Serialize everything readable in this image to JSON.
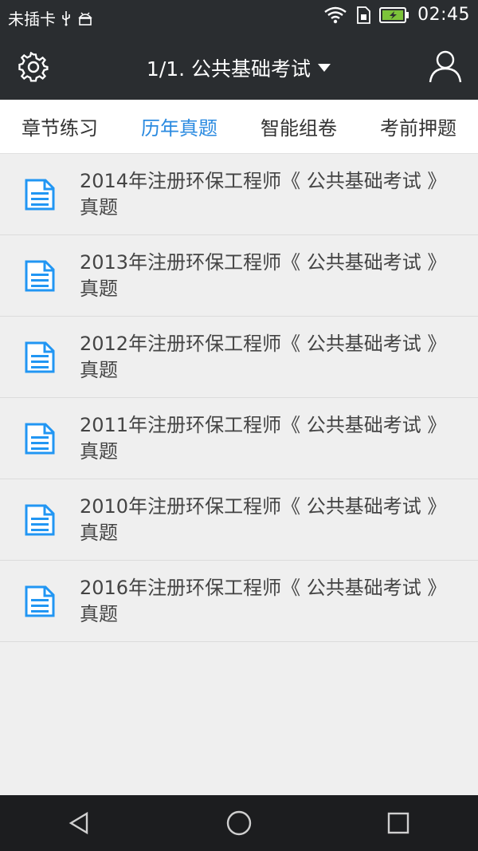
{
  "status_bar": {
    "carrier": "未插卡",
    "time": "02:45"
  },
  "app_bar": {
    "title": "1/1. 公共基础考试"
  },
  "tabs": [
    {
      "label": "章节练习",
      "active": false
    },
    {
      "label": "历年真题",
      "active": true
    },
    {
      "label": "智能组卷",
      "active": false
    },
    {
      "label": "考前押题",
      "active": false
    }
  ],
  "items": [
    {
      "title": "2014年注册环保工程师《 公共基础考试 》真题"
    },
    {
      "title": "2013年注册环保工程师《 公共基础考试 》真题"
    },
    {
      "title": "2012年注册环保工程师《 公共基础考试 》真题"
    },
    {
      "title": "2011年注册环保工程师《 公共基础考试 》真题"
    },
    {
      "title": "2010年注册环保工程师《 公共基础考试 》真题"
    },
    {
      "title": "2016年注册环保工程师《 公共基础考试 》真题"
    }
  ],
  "colors": {
    "bar_bg": "#2a2d30",
    "accent": "#2a8ae0",
    "list_bg": "#efefef",
    "icon_blue": "#2196f3"
  },
  "icons": {
    "settings": "gear-icon",
    "user": "user-icon",
    "dropdown": "caret-down-icon",
    "document": "document-icon",
    "back": "back-icon",
    "home": "home-icon",
    "recent": "recent-apps-icon"
  }
}
